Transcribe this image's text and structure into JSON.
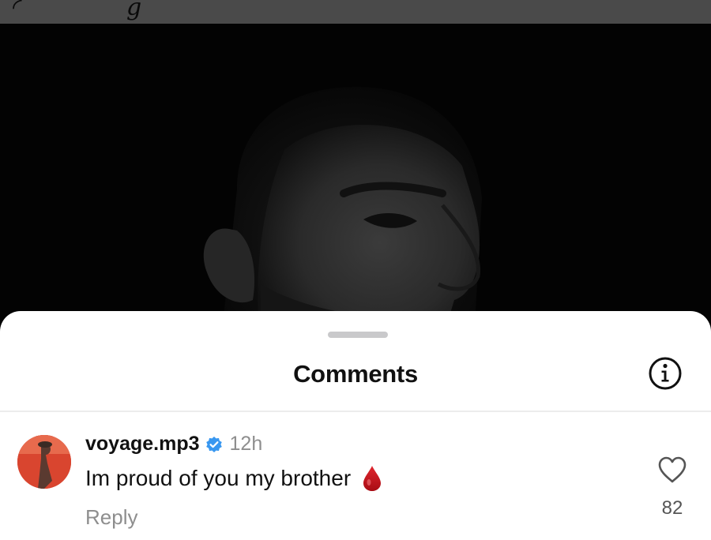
{
  "sheet": {
    "title": "Comments"
  },
  "icons": {
    "info": "info-circle-icon",
    "verified": "verified-badge-icon",
    "emoji": "blood-drop-emoji",
    "like": "heart-outline-icon"
  },
  "colors": {
    "verified_blue": "#3897f0",
    "drop_red": "#c4141b",
    "secondary_text": "#8e8e8e"
  },
  "comment": {
    "username": "voyage.mp3",
    "time": "12h",
    "text": "Im proud of you my brother",
    "reply_label": "Reply",
    "like_count": "82"
  }
}
